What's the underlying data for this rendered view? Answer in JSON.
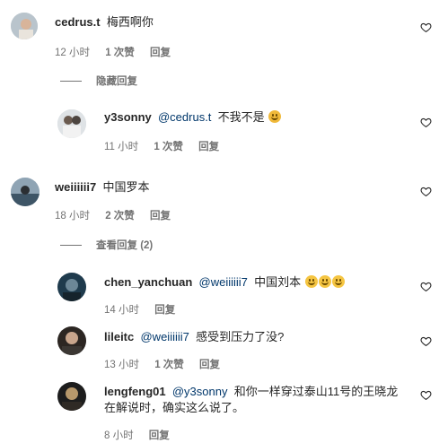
{
  "comments": [
    {
      "user": "cedrus.t",
      "mention": "",
      "text": "梅西啊你",
      "time": "12 小时",
      "likes": "1 次赞",
      "reply": "回复",
      "toggle": "隐藏回复"
    },
    {
      "user": "y3sonny",
      "mention": "@cedrus.t",
      "text": "不我不是",
      "emoji": "thinking-face-emoji",
      "time": "11 小时",
      "likes": "1 次赞",
      "reply": "回复"
    },
    {
      "user": "weiiiiii7",
      "mention": "",
      "text": "中国罗本",
      "time": "18 小时",
      "likes": "2 次赞",
      "reply": "回复",
      "toggle": "查看回复 (2)"
    },
    {
      "user": "chen_yanchuan",
      "mention": "@weiiiiii7",
      "text": "中国刘本",
      "emoji": "grinning-sweat-emoji x3",
      "time": "14 小时",
      "reply": "回复"
    },
    {
      "user": "lileitc",
      "mention": "@weiiiiii7",
      "text": "感受到压力了没?",
      "time": "13 小时",
      "likes": "1 次赞",
      "reply": "回复"
    },
    {
      "user": "lengfeng01",
      "mention": "@y3sonny",
      "text": "和你一样穿过泰山11号的王晓龙在解说时，确实这么说了。",
      "time": "8 小时",
      "reply": "回复"
    }
  ],
  "icons": {
    "like": "heart-icon"
  },
  "colors": {
    "mention": "#00376b",
    "meta": "#737373",
    "text": "#262626"
  }
}
